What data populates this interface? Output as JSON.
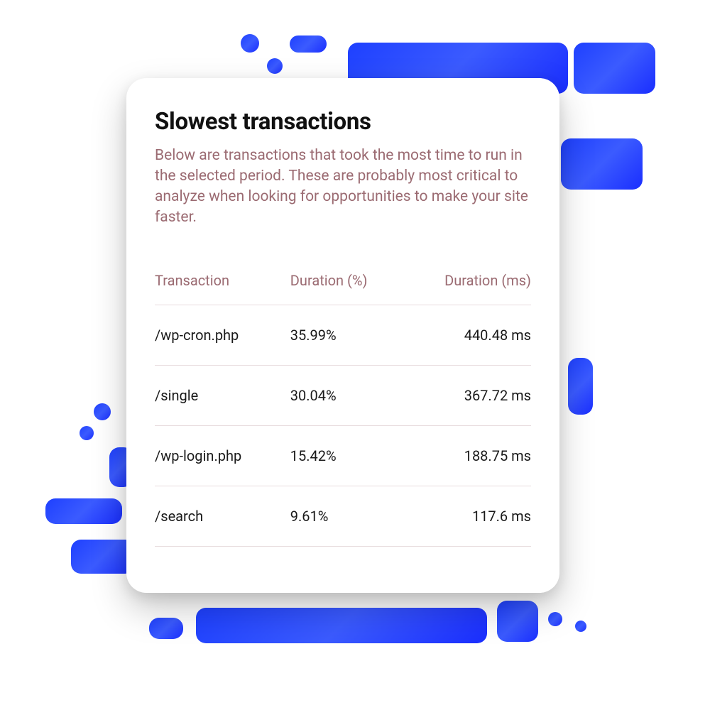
{
  "card": {
    "title": "Slowest transactions",
    "subtitle": "Below are transactions that took the most time to run in the selected period. These are probably most critical to analyze when looking for opportunities to make your site faster."
  },
  "table": {
    "headers": {
      "transaction": "Transaction",
      "duration_pct": "Duration (%)",
      "duration_ms": "Duration (ms)"
    },
    "rows": [
      {
        "transaction": "/wp-cron.php",
        "pct": "35.99%",
        "ms": "440.48 ms"
      },
      {
        "transaction": "/single",
        "pct": "30.04%",
        "ms": "367.72 ms"
      },
      {
        "transaction": "/wp-login.php",
        "pct": "15.42%",
        "ms": "188.75 ms"
      },
      {
        "transaction": "/search",
        "pct": "9.61%",
        "ms": "117.6 ms"
      }
    ]
  }
}
